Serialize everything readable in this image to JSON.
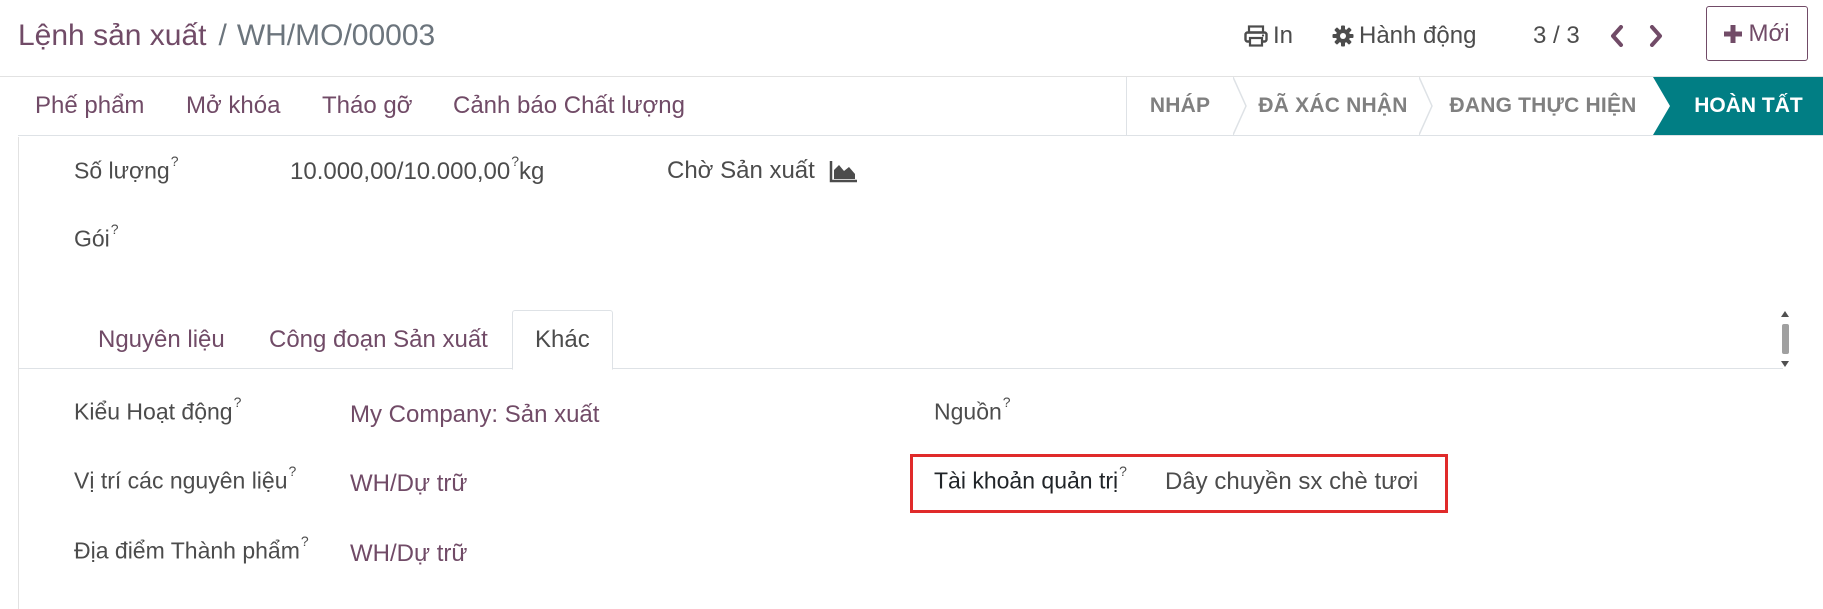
{
  "breadcrumb": {
    "parent": "Lệnh sản xuất",
    "separator": "/",
    "current": "WH/MO/00003"
  },
  "toolbar": {
    "print_label": "In",
    "action_label": "Hành động",
    "pager_value": "3 / 3",
    "new_label": "Mới"
  },
  "actions": [
    "Phế phẩm",
    "Mở khóa",
    "Tháo gỡ",
    "Cảnh báo Chất lượng"
  ],
  "stages": [
    {
      "label": "NHÁP"
    },
    {
      "label": "ĐÃ XÁC NHẬN"
    },
    {
      "label": "ĐANG THỰC HIỆN"
    },
    {
      "label": "HOÀN TẤT"
    }
  ],
  "fields": {
    "quantity_label": "Số lượng",
    "quantity_value": "10.000,00/10.000,00",
    "quantity_unit": "kg",
    "production_status": "Chờ Sản xuất",
    "package_label": "Gói"
  },
  "tabs": [
    "Nguyên liệu",
    "Công đoạn Sản xuất",
    "Khác"
  ],
  "other": {
    "operation_type_label": "Kiểu Hoạt động",
    "operation_type_value": "My Company: Sản xuất",
    "source_location_label": "Vị trí các nguyên liệu",
    "source_location_value": "WH/Dự trữ",
    "dest_location_label": "Địa điểm Thành phẩm",
    "dest_location_value": "WH/Dự trữ",
    "origin_label": "Nguồn",
    "analytic_label": "Tài khoản quản trị",
    "analytic_value": "Dây chuyền sx chè tươi"
  },
  "help_mark": "?",
  "colors": {
    "brand": "#714b67",
    "done_stage": "#017e84",
    "highlight": "#e02a2a"
  }
}
